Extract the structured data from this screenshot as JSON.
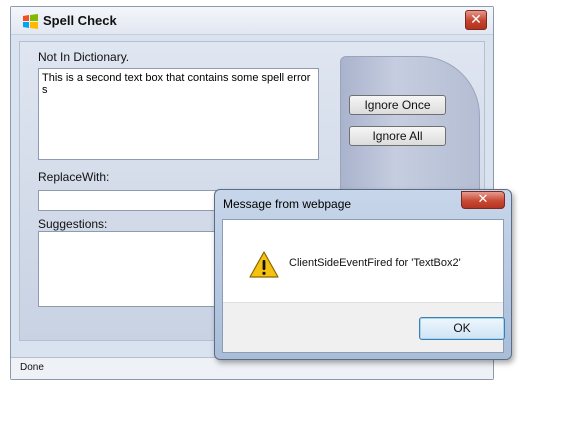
{
  "spell_window": {
    "title": "Spell Check",
    "not_in_dictionary_label": "Not In Dictionary.",
    "not_in_dictionary_text": "This is a second text box that contains some spell errors",
    "replace_with_label": "ReplaceWith:",
    "replace_with_value": "",
    "suggestions_label": "Suggestions:",
    "suggestions": [],
    "buttons": {
      "ignore_once": "Ignore Once",
      "ignore_all": "Ignore All"
    },
    "status": "Done",
    "close_symbol": "✕"
  },
  "message_dialog": {
    "title": "Message from webpage",
    "message": "ClientSideEventFired for 'TextBox2'",
    "ok_label": "OK",
    "close_symbol": "✕",
    "icon": "warning-icon"
  },
  "colors": {
    "close_red": "#c2432e",
    "warning_yellow": "#f5c211",
    "ok_border": "#3c7fb1"
  }
}
